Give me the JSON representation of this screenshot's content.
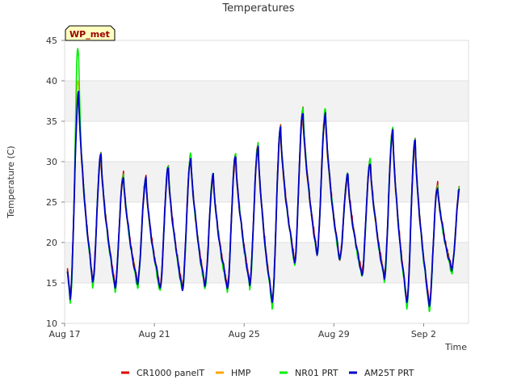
{
  "chart_data": {
    "type": "line",
    "title": "Temperatures",
    "xlabel": "Time",
    "ylabel": "Temperature (C)",
    "badge": "WP_met",
    "ylim": [
      10,
      45
    ],
    "yticks": [
      10,
      15,
      20,
      25,
      30,
      35,
      40,
      45
    ],
    "xlim": [
      "2023-08-17",
      "2023-09-04"
    ],
    "xticks": [
      {
        "date": "2023-08-17",
        "label": "Aug 17"
      },
      {
        "date": "2023-08-21",
        "label": "Aug 21"
      },
      {
        "date": "2023-08-25",
        "label": "Aug 25"
      },
      {
        "date": "2023-08-29",
        "label": "Aug 29"
      },
      {
        "date": "2023-09-02",
        "label": "Sep 2"
      }
    ],
    "grid": true,
    "legend_position": "bottom",
    "series": [
      {
        "name": "CR1000 panelT",
        "color": "#dd0000"
      },
      {
        "name": "HMP",
        "color": "#ffa500"
      },
      {
        "name": "NR01 PRT",
        "color": "#00ee00"
      },
      {
        "name": "AM25T PRT",
        "color": "#0000cc"
      }
    ],
    "daily": [
      {
        "date": "2023-08-17",
        "min": 13.0,
        "max": 38.5
      },
      {
        "date": "2023-08-18",
        "min": 15.0,
        "max": 30.8
      },
      {
        "date": "2023-08-19",
        "min": 14.5,
        "max": 28.3
      },
      {
        "date": "2023-08-20",
        "min": 14.8,
        "max": 27.8
      },
      {
        "date": "2023-08-21",
        "min": 14.3,
        "max": 29.2
      },
      {
        "date": "2023-08-22",
        "min": 14.2,
        "max": 30.6
      },
      {
        "date": "2023-08-23",
        "min": 14.5,
        "max": 28.2
      },
      {
        "date": "2023-08-24",
        "min": 14.3,
        "max": 30.7
      },
      {
        "date": "2023-08-25",
        "min": 14.8,
        "max": 32.0
      },
      {
        "date": "2023-08-26",
        "min": 12.5,
        "max": 34.0
      },
      {
        "date": "2023-08-27",
        "min": 17.5,
        "max": 36.2
      },
      {
        "date": "2023-08-28",
        "min": 18.5,
        "max": 36.0
      },
      {
        "date": "2023-08-29",
        "min": 17.8,
        "max": 28.2
      },
      {
        "date": "2023-08-30",
        "min": 16.0,
        "max": 30.0
      },
      {
        "date": "2023-08-31",
        "min": 15.5,
        "max": 33.8
      },
      {
        "date": "2023-09-01",
        "min": 12.5,
        "max": 32.5
      },
      {
        "date": "2023-09-02",
        "min": 12.2,
        "max": 27.0
      },
      {
        "date": "2023-09-03",
        "min": 16.5,
        "max": 27.0
      }
    ],
    "peaks": [
      {
        "series": "NR01 PRT",
        "date": "2023-08-17",
        "value": 44.0
      },
      {
        "series": "HMP",
        "date": "2023-08-17",
        "value": 40.0
      }
    ]
  }
}
